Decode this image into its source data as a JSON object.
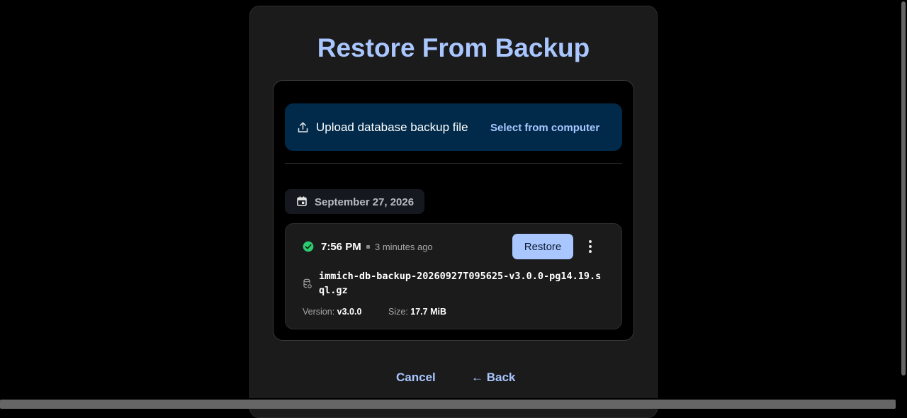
{
  "dialog": {
    "title": "Restore From Backup",
    "upload": {
      "label": "Upload database backup file",
      "select_link": "Select from computer"
    },
    "date_group": {
      "date": "September 27, 2026"
    },
    "backup": {
      "time": "7:56 PM",
      "relative": "3 minutes ago",
      "restore_label": "Restore",
      "filename": "immich-db-backup-20260927T095625-v3.0.0-pg14.19.sql.gz",
      "version_label": "Version:",
      "version_value": "v3.0.0",
      "size_label": "Size:",
      "size_value": "17.7 MiB",
      "status": "success"
    },
    "footer": {
      "cancel_label": "Cancel",
      "back_label": "← Back"
    }
  },
  "colors": {
    "accent": "#a9c6ff",
    "upload_bg": "#012a4a",
    "success": "#2ecc71",
    "panel_bg": "#1b1b1b"
  },
  "icons": [
    "upload-icon",
    "calendar-icon",
    "check-circle-icon",
    "more-vertical-icon",
    "database-file-icon"
  ]
}
